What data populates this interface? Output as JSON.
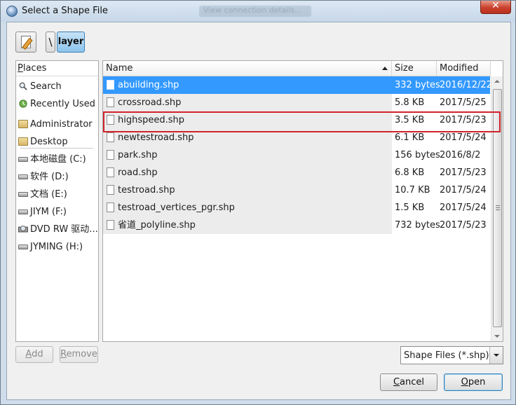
{
  "window": {
    "title": "Select a Shape File",
    "background_title": "View connection details..."
  },
  "path": {
    "separator": "\\",
    "current": "layer"
  },
  "places": {
    "header": "Places",
    "header_mnemonic": "P",
    "header_rest": "laces",
    "items": [
      {
        "label": "Search",
        "icon": "search-icon"
      },
      {
        "label": "Recently Used",
        "icon": "recent-icon"
      },
      {
        "label": "Administrator",
        "icon": "folder-icon"
      },
      {
        "label": "Desktop",
        "icon": "folder-icon"
      },
      {
        "label": "本地磁盘 (C:)",
        "icon": "drive-icon"
      },
      {
        "label": "软件 (D:)",
        "icon": "drive-icon"
      },
      {
        "label": "文档 (E:)",
        "icon": "drive-icon"
      },
      {
        "label": "JIYM (F:)",
        "icon": "drive-icon"
      },
      {
        "label": "DVD RW 驱动...",
        "icon": "dvd-drive-icon"
      },
      {
        "label": "JYMING (H:)",
        "icon": "drive-icon"
      }
    ]
  },
  "files": {
    "columns": {
      "name": "Name",
      "size": "Size",
      "modified": "Modified"
    },
    "sort_column": "Name",
    "rows": [
      {
        "name": "abuilding.shp",
        "size": "332 bytes",
        "modified": "2016/12/22",
        "selected": true
      },
      {
        "name": "crossroad.shp",
        "size": "5.8 KB",
        "modified": "2017/5/25",
        "selected": false
      },
      {
        "name": "highspeed.shp",
        "size": "3.5 KB",
        "modified": "2017/5/23",
        "selected": false
      },
      {
        "name": "newtestroad.shp",
        "size": "6.1 KB",
        "modified": "2017/5/24",
        "selected": false
      },
      {
        "name": "park.shp",
        "size": "156 bytes",
        "modified": "2016/8/2",
        "selected": false
      },
      {
        "name": "road.shp",
        "size": "6.8 KB",
        "modified": "2017/5/23",
        "selected": false
      },
      {
        "name": "testroad.shp",
        "size": "10.7 KB",
        "modified": "2017/5/24",
        "selected": false
      },
      {
        "name": "testroad_vertices_pgr.shp",
        "size": "1.5 KB",
        "modified": "2017/5/24",
        "selected": false
      },
      {
        "name": "省道_polyline.shp",
        "size": "732 bytes",
        "modified": "2017/5/23",
        "selected": false
      }
    ]
  },
  "buttons": {
    "add": "Add",
    "add_mnemonic": "A",
    "add_rest": "dd",
    "remove": "Remove",
    "remove_mnemonic": "R",
    "remove_rest": "emove",
    "cancel": "Cancel",
    "cancel_mnemonic": "C",
    "cancel_rest": "ancel",
    "open": "Open",
    "open_mnemonic": "O",
    "open_rest": "pen"
  },
  "filter": {
    "selected": "Shape Files (*.shp)"
  },
  "colors": {
    "selection": "#3399ff",
    "highlight_box": "#d2232a"
  }
}
